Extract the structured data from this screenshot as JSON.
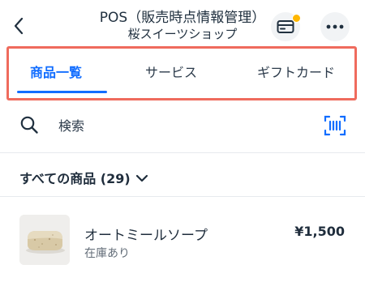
{
  "colors": {
    "accent": "#116dff",
    "highlight_frame": "#ef6b5d",
    "notification_dot": "#ffb700"
  },
  "header": {
    "title": "POS（販売時点情報管理）",
    "subtitle": "桜スイーツショップ",
    "back_icon": "chevron-left-icon",
    "cards_icon": "credit-card-icon",
    "more_icon": "more-horizontal-icon"
  },
  "tabs": [
    {
      "label": "商品一覧",
      "active": true
    },
    {
      "label": "サービス",
      "active": false
    },
    {
      "label": "ギフトカード",
      "active": false
    }
  ],
  "search": {
    "placeholder": "検索",
    "search_icon": "search-icon",
    "scan_icon": "barcode-scan-icon"
  },
  "filter": {
    "label": "すべての商品 (29)",
    "icon": "chevron-down-icon"
  },
  "products": [
    {
      "name": "オートミールソープ",
      "stock": "在庫あり",
      "price": "¥1,500"
    }
  ]
}
